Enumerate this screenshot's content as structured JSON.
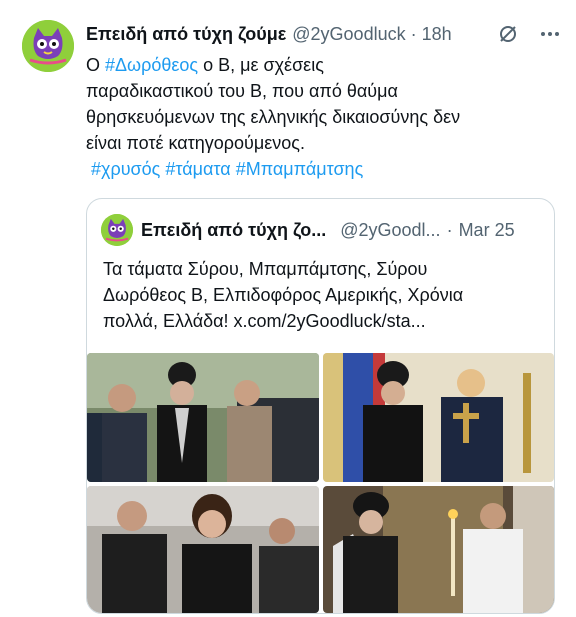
{
  "tweet": {
    "name": "Επειδή από τύχη ζούμε",
    "handle": "@2yGoodluck",
    "separator": "·",
    "time": "18h",
    "text_intro": "Ο ",
    "hashtag_1": "#Δωρόθεος",
    "text_line1_rest": " ο Β, με σχέσεις",
    "text_line2": " παραδικαστικού του Β, που από θαύμα",
    "text_line3": "θρησκευόμενων της ελληνικής δικαιοσύνης δεν",
    "text_line4": "είναι ποτέ κατηγορούμενος.",
    "hashtags": [
      "#χρυσός",
      "#τάματα",
      "#Μπαμπάμτσης"
    ]
  },
  "quote": {
    "name": "Επειδή από τύχη ζο...",
    "handle": "@2yGoodl...",
    "separator": "·",
    "time": "Mar 25",
    "text_line1": "Τα τάματα Σύρου, Μπαμπάμτσης, Σύρου",
    "text_line2": "Δωρόθεος Β, Ελπιδοφόρος Αμερικής, Χρόνια",
    "text_line3": "πολλά, Ελλάδα!  x.com/2yGoodluck/sta..."
  },
  "icons": {
    "grok": "grok-icon",
    "more": "more-icon",
    "avatar": "cat-avatar-icon"
  },
  "colors": {
    "accent": "#1d9bf0",
    "secondary_text": "#536471",
    "border": "#cfd9de",
    "avatar_bg": "#8fcf3b"
  }
}
